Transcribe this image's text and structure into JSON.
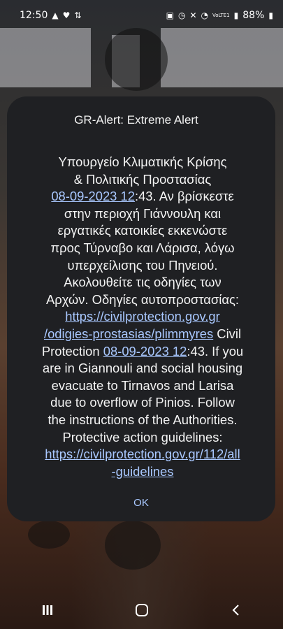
{
  "status_bar": {
    "time": "12:50",
    "battery": "88%",
    "network": "VoLTE1"
  },
  "dialog": {
    "title": "GR-Alert: Extreme Alert",
    "body_lines": [
      "Υπουργείο Κλιματικής Κρίσης",
      "& Πολιτικής Προστασίας",
      "08-09-2023 12",
      ":43. Αν βρίσκεστε",
      "στην περιοχή Γιάννουλη και",
      "εργατικές κατοικίες εκκενώστε",
      "προς Τύρναβο και Λάρισα, λόγω",
      "υπερχείλισης του Πηνειού.",
      "Ακολουθείτε τις οδηγίες των",
      "Αρχών. Οδηγίες αυτοπροστασίας:",
      "https://civilprotection.gov.gr",
      "/odigies-prostasias/plimmyres",
      " Civil",
      "Protection ",
      "08-09-2023 12",
      ":43. If you",
      "are in Giannouli and social housing",
      "evacuate to Tirnavos and Larisa",
      "due to overflow of Pinios. Follow",
      "the instructions of the Authorities.",
      "Protective action guidelines:",
      "https://civilprotection.gov.gr/112/all",
      "-guidelines"
    ],
    "ok_label": "OK"
  }
}
